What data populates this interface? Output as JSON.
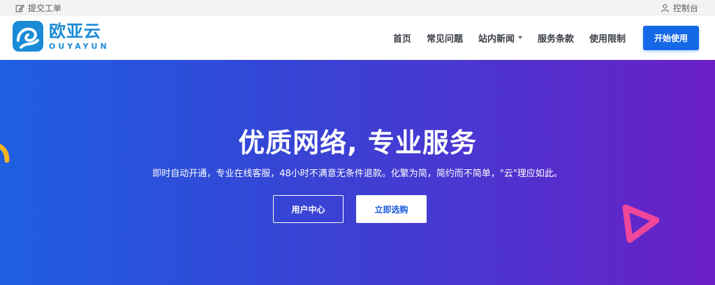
{
  "topbar": {
    "ticket_label": "提交工单",
    "console_label": "控制台"
  },
  "header": {
    "logo_cn": "欧亚云",
    "logo_en": "OUYAYUN",
    "nav": [
      {
        "label": "首页"
      },
      {
        "label": "常见问题"
      },
      {
        "label": "站内新闻",
        "dropdown": true
      },
      {
        "label": "服务条款"
      },
      {
        "label": "使用限制"
      }
    ],
    "cta_label": "开始使用"
  },
  "hero": {
    "title": "优质网络, 专业服务",
    "subtitle": "即时自动开通，专业在线客服，48小时不满意无条件退款。化繁为简，简约而不简单，\"云\"理应如此。",
    "btn_user_center": "用户中心",
    "btn_buy": "立即选购"
  },
  "colors": {
    "brand": "#1a8bd6",
    "cta": "#1468e6",
    "hero_gradient_start": "#1f5fe0",
    "hero_gradient_end": "#6a1fc6",
    "deco_yellow": "#f4b223",
    "deco_pink": "#f0479a"
  }
}
